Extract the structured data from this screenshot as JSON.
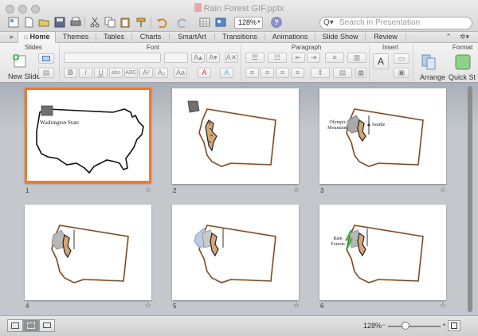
{
  "window": {
    "title": "Rain Forest GIF.pptx",
    "zoom": "128%",
    "search_placeholder": "Search in Presentation"
  },
  "ribbon_tabs": [
    {
      "label": "Home",
      "active": true
    },
    {
      "label": "Themes"
    },
    {
      "label": "Tables"
    },
    {
      "label": "Charts"
    },
    {
      "label": "SmartArt"
    },
    {
      "label": "Transitions"
    },
    {
      "label": "Animations"
    },
    {
      "label": "Slide Show"
    },
    {
      "label": "Review"
    }
  ],
  "ribbon": {
    "groups": {
      "slides": "Slides",
      "font": "Font",
      "paragraph": "Paragraph",
      "insert": "Insert",
      "format": "Format"
    },
    "new_slide_label": "New Slide",
    "arrange_label": "Arrange",
    "quick_styles_label": "Quick St"
  },
  "slides": [
    {
      "number": "1",
      "label": "Washington State",
      "selected": true
    },
    {
      "number": "2"
    },
    {
      "number": "3",
      "labels": [
        "Olympic Mountains",
        "Seattle"
      ]
    },
    {
      "number": "4"
    },
    {
      "number": "5"
    },
    {
      "number": "6",
      "labels": [
        "Rain Forests"
      ]
    }
  ],
  "status": {
    "zoom": "128%"
  },
  "colors": {
    "selection_border": "#ef7a2e",
    "state_outline": "#c98a5a",
    "forest_green": "#3bb54a"
  }
}
